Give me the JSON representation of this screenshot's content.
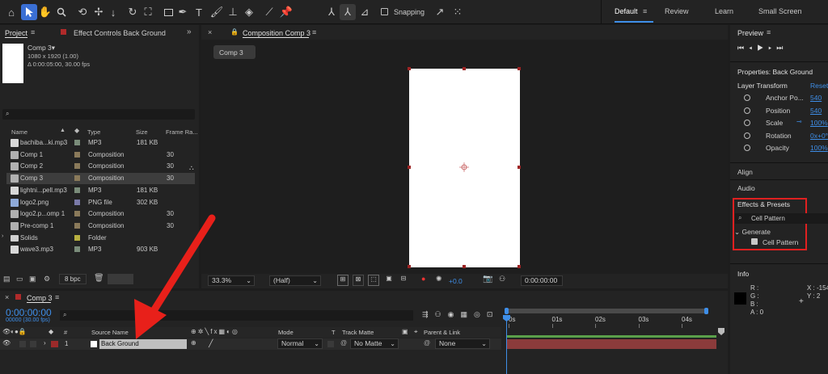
{
  "toolbar": {
    "snapping_label": "Snapping",
    "workspaces": [
      "Default",
      "Review",
      "Learn",
      "Small Screen"
    ],
    "active_workspace": "Default"
  },
  "project": {
    "tab_project": "Project",
    "tab_effect_controls": "Effect Controls Back Ground",
    "comp_name": "Comp 3",
    "comp_size": "1080 x 1920 (1.00)",
    "comp_duration": "Δ 0:00:05:00, 30.00 fps",
    "search_placeholder": "",
    "columns": {
      "name": "Name",
      "type": "Type",
      "size": "Size",
      "frame_rate": "Frame Ra..."
    },
    "items": [
      {
        "name": "bachiba...ki.mp3",
        "type": "MP3",
        "size": "181 KB",
        "fr": "",
        "kind": "audio",
        "color": "#7a8c7a"
      },
      {
        "name": "Comp 1",
        "type": "Composition",
        "size": "",
        "fr": "30",
        "kind": "comp",
        "color": "#8a7a5a"
      },
      {
        "name": "Comp 2",
        "type": "Composition",
        "size": "",
        "fr": "30",
        "kind": "comp",
        "color": "#8a7a5a"
      },
      {
        "name": "Comp 3",
        "type": "Composition",
        "size": "",
        "fr": "30",
        "kind": "comp",
        "color": "#8a7a5a",
        "selected": true
      },
      {
        "name": "lightni...pell.mp3",
        "type": "MP3",
        "size": "181 KB",
        "fr": "",
        "kind": "audio",
        "color": "#7a8c7a"
      },
      {
        "name": "logo2.png",
        "type": "PNG file",
        "size": "302 KB",
        "fr": "",
        "kind": "image",
        "color": "#7a7aa8"
      },
      {
        "name": "logo2.p...omp 1",
        "type": "Composition",
        "size": "",
        "fr": "30",
        "kind": "comp",
        "color": "#8a7a5a"
      },
      {
        "name": "Pre-comp 1",
        "type": "Composition",
        "size": "",
        "fr": "30",
        "kind": "comp",
        "color": "#8a7a5a"
      },
      {
        "name": "Solids",
        "type": "Folder",
        "size": "",
        "fr": "",
        "kind": "folder",
        "color": "#b8b040"
      },
      {
        "name": "wave3.mp3",
        "type": "MP3",
        "size": "903 KB",
        "fr": "",
        "kind": "audio",
        "color": "#7a8c7a"
      }
    ],
    "bpc": "8 bpc"
  },
  "composition": {
    "tab_label": "Composition Comp 3",
    "flow_chip": "Comp 3",
    "zoom": "33.3%",
    "resolution": "(Half)",
    "exposure": "+0.0",
    "timecode": "0:00:00:00"
  },
  "right": {
    "preview_title": "Preview",
    "properties_title": "Properties: Back Ground",
    "layer_transform": "Layer Transform",
    "reset": "Reset",
    "transform_props": [
      {
        "name": "Anchor Po...",
        "value": "540"
      },
      {
        "name": "Position",
        "value": "540"
      },
      {
        "name": "Scale",
        "value": "100%"
      },
      {
        "name": "Rotation",
        "value": "0x+0°"
      },
      {
        "name": "Opacity",
        "value": "100%"
      }
    ],
    "align": "Align",
    "audio": "Audio",
    "effects_title": "Effects & Presets",
    "effects_search": "Cell Pattern",
    "effects_category": "Generate",
    "effects_item": "Cell Pattern",
    "info_title": "Info",
    "info_r": "R :",
    "info_g": "G :",
    "info_b": "B :",
    "info_a": "A :  0",
    "info_x": "X : -154",
    "info_y": "Y : 2"
  },
  "timeline": {
    "tab_label": "Comp 3",
    "timecode": "0:00:00:00",
    "fps_line": "00000 (30.00 fps)",
    "columns": {
      "source_name": "Source Name",
      "mode": "Mode",
      "t": "T",
      "track_matte": "Track Matte",
      "parent_link": "Parent & Link"
    },
    "layer": {
      "number": "1",
      "name": "Back Ground",
      "mode": "Normal",
      "matte": "No Matte",
      "parent": "None"
    },
    "ruler": [
      "0s",
      "01s",
      "02s",
      "03s",
      "04s"
    ]
  },
  "colors": {
    "accent_blue": "#3e8ee8",
    "highlight_red": "#e02020",
    "arrow_red": "#e8201a",
    "layer_bar": "#8b3b3b",
    "work_area": "#5aa04a"
  }
}
